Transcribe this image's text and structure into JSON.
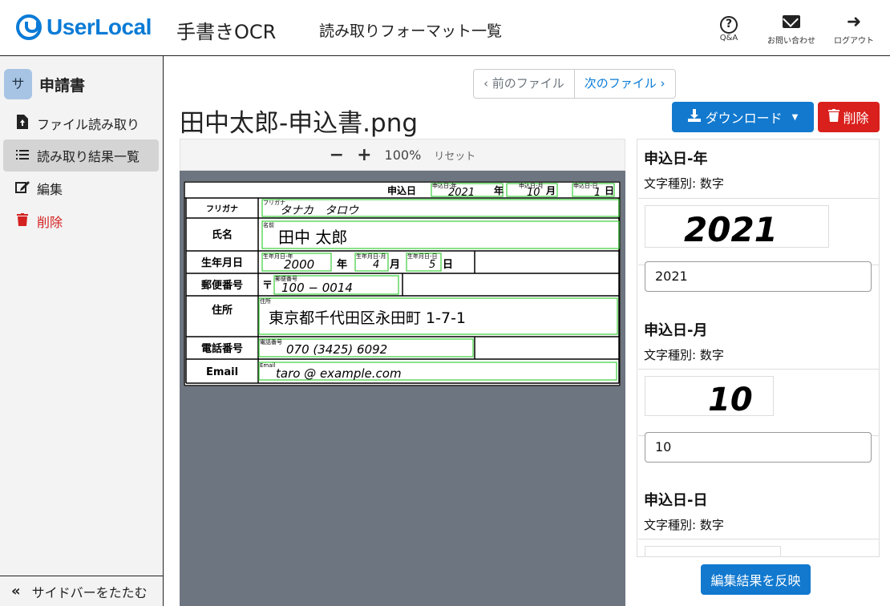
{
  "header": {
    "logo": "UserLocal",
    "app_name": "手書きOCR",
    "nav_format": "読み取りフォーマット一覧",
    "icons": [
      {
        "icon": "question-circle-icon",
        "label": "Q&A"
      },
      {
        "icon": "envelope-icon",
        "label": "お問い合わせ"
      },
      {
        "icon": "sign-out-icon",
        "label": "ログアウト"
      }
    ]
  },
  "sidebar": {
    "avatar": "サ",
    "title": "申請書",
    "items": [
      {
        "icon": "file-upload-icon",
        "label": "ファイル読み取り"
      },
      {
        "icon": "list-icon",
        "label": "読み取り結果一覧"
      },
      {
        "icon": "edit-icon",
        "label": "編集"
      },
      {
        "icon": "trash-icon",
        "label": "削除"
      }
    ],
    "collapse": "サイドバーをたたむ"
  },
  "pager": {
    "prev": "‹ 前のファイル",
    "next": "次のファイル ›"
  },
  "file_title": "田中太郎-申込書.png",
  "buttons": {
    "download": "ダウンロード",
    "delete": "削除",
    "apply": "編集結果を反映"
  },
  "viewer": {
    "zoom_out": "−",
    "zoom_in": "+",
    "zoom": "100%",
    "reset": "リセット"
  },
  "doc": {
    "header_label": "申込日",
    "year": "2021",
    "year_unit": "年",
    "month": "10",
    "month_unit": "月",
    "day": "1",
    "day_unit": "日",
    "box_year": "申込日-年",
    "box_month": "申込日-月",
    "box_day": "申込日-日",
    "rows": {
      "furigana": {
        "label": "フリガナ",
        "box": "フリガナ",
        "value": "タナカ　タロウ"
      },
      "name": {
        "label": "氏名",
        "box": "名前",
        "value": "田中 太郎"
      },
      "birth": {
        "label": "生年月日",
        "box_y": "生年月日-年",
        "y": "2000",
        "yu": "年",
        "box_m": "生年月日-月",
        "m": "4",
        "mu": "月",
        "box_d": "生年月日-日",
        "d": "5",
        "du": "日"
      },
      "postal": {
        "label": "郵便番号",
        "mark": "〒",
        "box": "郵便番号",
        "value": "100 − 0014"
      },
      "address": {
        "label": "住所",
        "box": "住所",
        "value": "東京都千代田区永田町 1-7-1"
      },
      "phone": {
        "label": "電話番号",
        "box": "電話番号",
        "value": "070 (3425) 6092"
      },
      "email": {
        "label": "Email",
        "box": "Email",
        "value": "taro @ example.com"
      }
    }
  },
  "fields": [
    {
      "title": "申込日-年",
      "type": "文字種別: 数字",
      "image_text": "2021",
      "value": "2021"
    },
    {
      "title": "申込日-月",
      "type": "文字種別: 数字",
      "image_text": "10",
      "value": "10"
    },
    {
      "title": "申込日-日",
      "type": "文字種別: 数字"
    }
  ]
}
